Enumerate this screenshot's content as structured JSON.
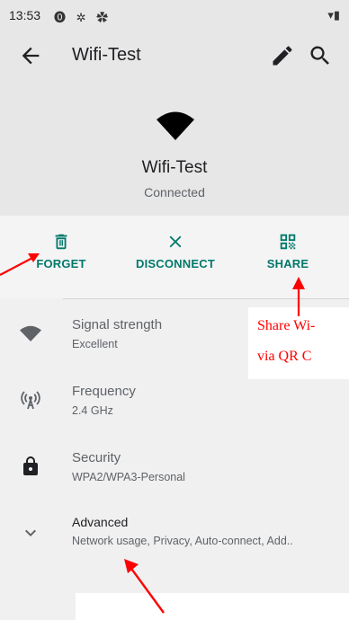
{
  "status_bar": {
    "time": "13:53",
    "left_icons": "⓿ ✲ ✿",
    "right_icons": "▾▮"
  },
  "app_bar": {
    "title": "Wifi-Test",
    "back_icon": "arrow-back-icon",
    "edit_icon": "pencil-icon",
    "search_icon": "search-icon"
  },
  "network": {
    "ssid": "Wifi-Test",
    "status": "Connected"
  },
  "actions": [
    {
      "label": "FORGET",
      "icon": "trash-icon"
    },
    {
      "label": "DISCONNECT",
      "icon": "close-icon"
    },
    {
      "label": "SHARE",
      "icon": "qr-code-icon"
    }
  ],
  "details": [
    {
      "title": "Signal strength",
      "value": "Excellent",
      "icon": "wifi-signal-icon"
    },
    {
      "title": "Frequency",
      "value": "2.4 GHz",
      "icon": "antenna-icon"
    },
    {
      "title": "Security",
      "value": "WPA2/WPA3-Personal",
      "icon": "lock-icon"
    },
    {
      "title": "Advanced",
      "value": "Network usage, Privacy, Auto-connect, Add..",
      "icon": "chevron-down-icon"
    }
  ],
  "annotation": {
    "line1": "Share Wi-",
    "line2": "via QR C"
  },
  "colors": {
    "accent": "#00796b",
    "annotation": "#ff0000",
    "header_bg": "#e7e7e7",
    "page_bg": "#f0f0f0"
  }
}
